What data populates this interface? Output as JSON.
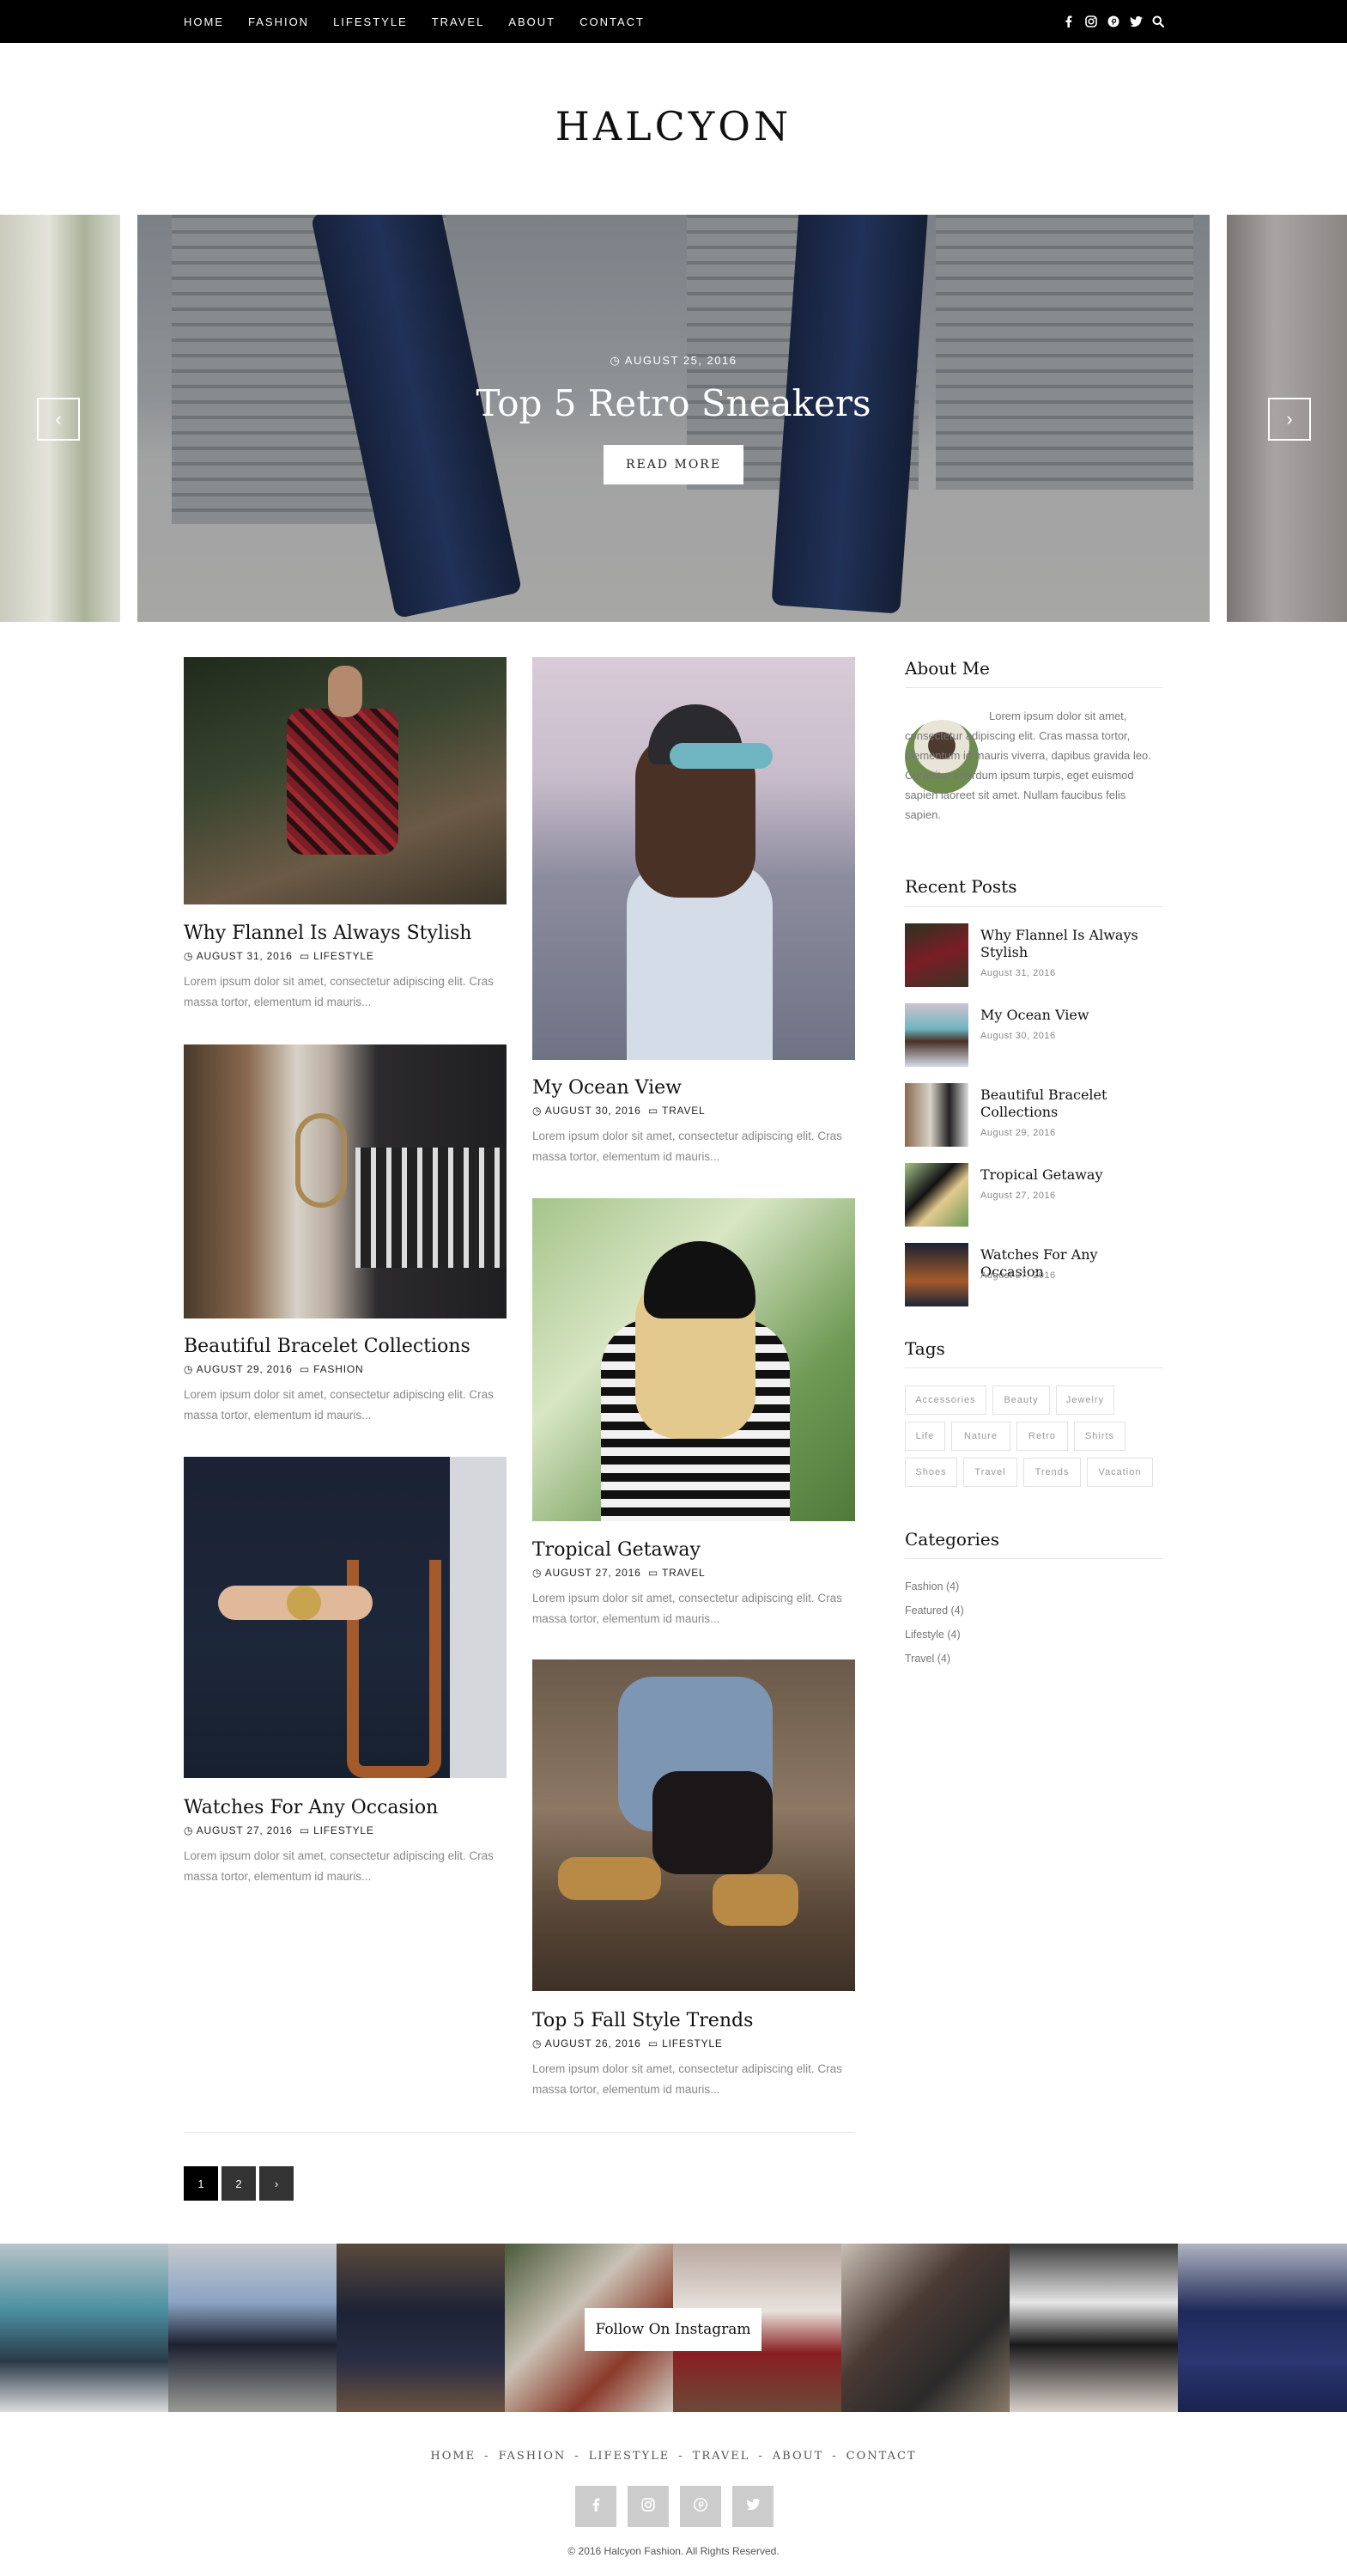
{
  "nav": {
    "menu": [
      "HOME",
      "FASHION",
      "LIFESTYLE",
      "TRAVEL",
      "ABOUT",
      "CONTACT"
    ],
    "social_icons": [
      "facebook-icon",
      "instagram-icon",
      "pinterest-icon",
      "twitter-icon",
      "search-icon"
    ]
  },
  "site": {
    "logo": "HALCYON"
  },
  "slider": {
    "date": "AUGUST 25, 2016",
    "title": "Top 5 Retro Sneakers",
    "button": "READ MORE",
    "prev": "‹",
    "next": "›"
  },
  "posts": [
    {
      "title": "Why Flannel Is Always Stylish",
      "date": "AUGUST 31, 2016",
      "category": "LIFESTYLE",
      "excerpt": "Lorem ipsum dolor sit amet, consectetur adipiscing elit. Cras massa tortor, elementum id mauris..."
    },
    {
      "title": "My Ocean View",
      "date": "AUGUST 30, 2016",
      "category": "TRAVEL",
      "excerpt": "Lorem ipsum dolor sit amet, consectetur adipiscing elit. Cras massa tortor, elementum id mauris..."
    },
    {
      "title": "Beautiful Bracelet Collections",
      "date": "AUGUST 29, 2016",
      "category": "FASHION",
      "excerpt": "Lorem ipsum dolor sit amet, consectetur adipiscing elit. Cras massa tortor, elementum id mauris..."
    },
    {
      "title": "Tropical Getaway",
      "date": "AUGUST 27, 2016",
      "category": "TRAVEL",
      "excerpt": "Lorem ipsum dolor sit amet, consectetur adipiscing elit. Cras massa tortor, elementum id mauris..."
    },
    {
      "title": "Watches For Any Occasion",
      "date": "AUGUST 27, 2016",
      "category": "LIFESTYLE",
      "excerpt": "Lorem ipsum dolor sit amet, consectetur adipiscing elit. Cras massa tortor, elementum id mauris..."
    },
    {
      "title": "Top 5 Fall Style Trends",
      "date": "AUGUST 26, 2016",
      "category": "LIFESTYLE",
      "excerpt": "Lorem ipsum dolor sit amet, consectetur adipiscing elit. Cras massa tortor, elementum id mauris..."
    }
  ],
  "sidebar": {
    "about": {
      "title": "About Me",
      "text": "Lorem ipsum dolor sit amet, consectetur adipiscing elit. Cras massa tortor, elementum id mauris viverra, dapibus gravida leo. Curabitur interdum ipsum turpis, eget euismod sapien laoreet sit amet. Nullam faucibus felis sapien."
    },
    "recent": {
      "title": "Recent Posts",
      "items": [
        {
          "title": "Why Flannel Is Always Stylish",
          "date": "August 31, 2016"
        },
        {
          "title": "My Ocean View",
          "date": "August 30, 2016"
        },
        {
          "title": "Beautiful Bracelet Collections",
          "date": "August 29, 2016"
        },
        {
          "title": "Tropical Getaway",
          "date": "August 27, 2016"
        },
        {
          "title": "Watches For Any Occasion",
          "date": "August 27, 2016"
        }
      ]
    },
    "tags": {
      "title": "Tags",
      "items": [
        "Accessories",
        "Beauty",
        "Jewelry",
        "Life",
        "Nature",
        "Retro",
        "Shirts",
        "Shoes",
        "Travel",
        "Trends",
        "Vacation"
      ]
    },
    "categories": {
      "title": "Categories",
      "items": [
        "Fashion (4)",
        "Featured (4)",
        "Lifestyle (4)",
        "Travel (4)"
      ]
    }
  },
  "pagination": {
    "pages": [
      "1",
      "2"
    ],
    "next": "›",
    "current": "1"
  },
  "instagram": {
    "button": "Follow On Instagram"
  },
  "footer": {
    "menu": [
      "HOME",
      "FASHION",
      "LIFESTYLE",
      "TRAVEL",
      "ABOUT",
      "CONTACT"
    ],
    "separator": "-",
    "social_icons": [
      "facebook-icon",
      "instagram-icon",
      "pinterest-icon",
      "twitter-icon"
    ],
    "copyright": "© 2016 Halcyon Fashion. All Rights Reserved."
  },
  "colors": {
    "nav_bg": "#000000",
    "accent": "#111111",
    "muted_text": "#888888",
    "footer_icon_bg": "#cccccc"
  }
}
